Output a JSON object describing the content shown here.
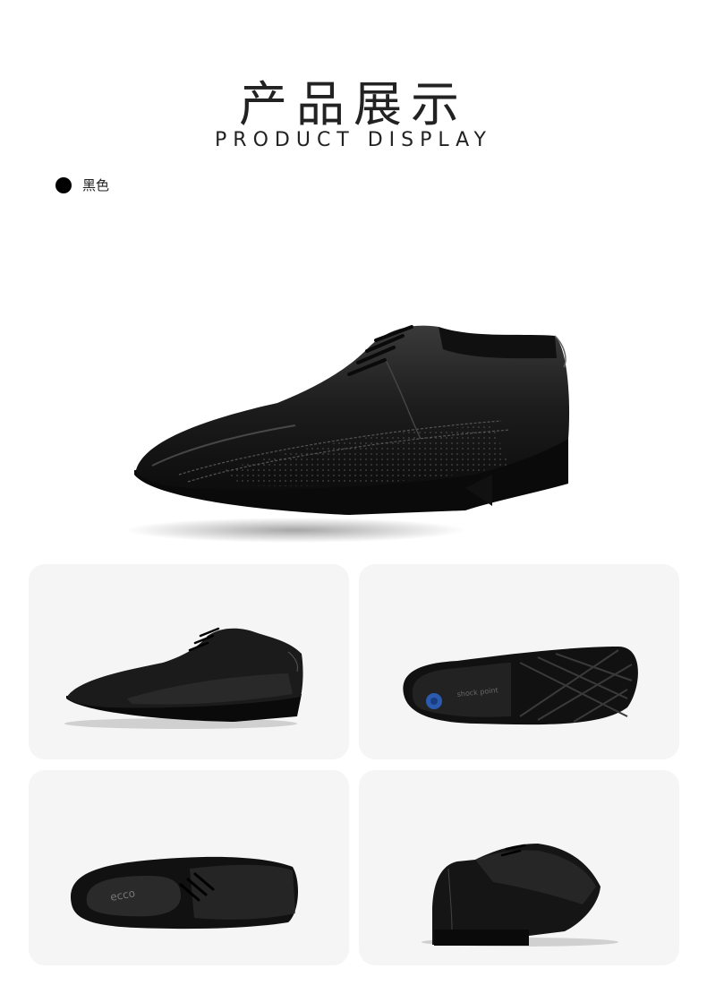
{
  "header": {
    "title_cn": "产品展示",
    "title_en": "PRODUCT DISPLAY"
  },
  "color_option": {
    "label": "黑色",
    "swatch": "#000000"
  },
  "images": {
    "hero": "shoe-side-view",
    "views": [
      "shoe-side-view",
      "shoe-sole-view",
      "shoe-top-view",
      "shoe-rear-view"
    ]
  },
  "colors": {
    "panel_bg": "#f5f5f5",
    "leather": "#1a1a1a"
  }
}
